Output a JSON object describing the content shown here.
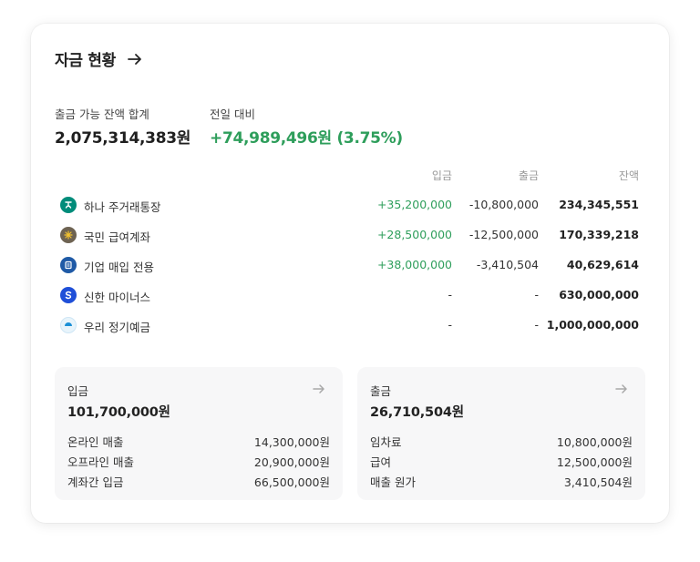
{
  "header": {
    "title": "자금 현황"
  },
  "summary": {
    "available_label": "출금 가능 잔액 합계",
    "available_value": "2,075,314,383원",
    "compare_label": "전일 대비",
    "compare_value": "+74,989,496원 (3.75%)"
  },
  "table": {
    "headers": {
      "deposit": "입금",
      "withdrawal": "출금",
      "balance": "잔액"
    },
    "rows": [
      {
        "icon": "hana-bank-icon",
        "color": "#008c7a",
        "name": "하나 주거래통장",
        "deposit": "+35,200,000",
        "withdrawal": "-10,800,000",
        "balance": "234,345,551"
      },
      {
        "icon": "kb-bank-icon",
        "color": "#6e6352",
        "name": "국민 급여계좌",
        "deposit": "+28,500,000",
        "withdrawal": "-12,500,000",
        "balance": "170,339,218"
      },
      {
        "icon": "ibk-bank-icon",
        "color": "#1f5aa6",
        "name": "기업 매입 전용",
        "deposit": "+38,000,000",
        "withdrawal": "-3,410,504",
        "balance": "40,629,614"
      },
      {
        "icon": "shinhan-bank-icon",
        "color": "#1f4fd8",
        "name": "신한 마이너스",
        "deposit": "-",
        "withdrawal": "-",
        "balance": "630,000,000"
      },
      {
        "icon": "woori-bank-icon",
        "color": "#1b8fd6",
        "name": "우리 정기예금",
        "deposit": "-",
        "withdrawal": "-",
        "balance": "1,000,000,000"
      }
    ]
  },
  "deposit_panel": {
    "label": "입금",
    "total": "101,700,000원",
    "items": [
      {
        "label": "온라인 매출",
        "value": "14,300,000원"
      },
      {
        "label": "오프라인 매출",
        "value": "20,900,000원"
      },
      {
        "label": "계좌간 입금",
        "value": "66,500,000원"
      }
    ]
  },
  "withdrawal_panel": {
    "label": "출금",
    "total": "26,710,504원",
    "items": [
      {
        "label": "임차료",
        "value": "10,800,000원"
      },
      {
        "label": "급여",
        "value": "12,500,000원"
      },
      {
        "label": "매출 원가",
        "value": "3,410,504원"
      }
    ]
  },
  "colors": {
    "positive": "#2e9e5b",
    "panel_bg": "#f7f7f8",
    "text": "#222222",
    "muted": "#9a9a9a"
  }
}
